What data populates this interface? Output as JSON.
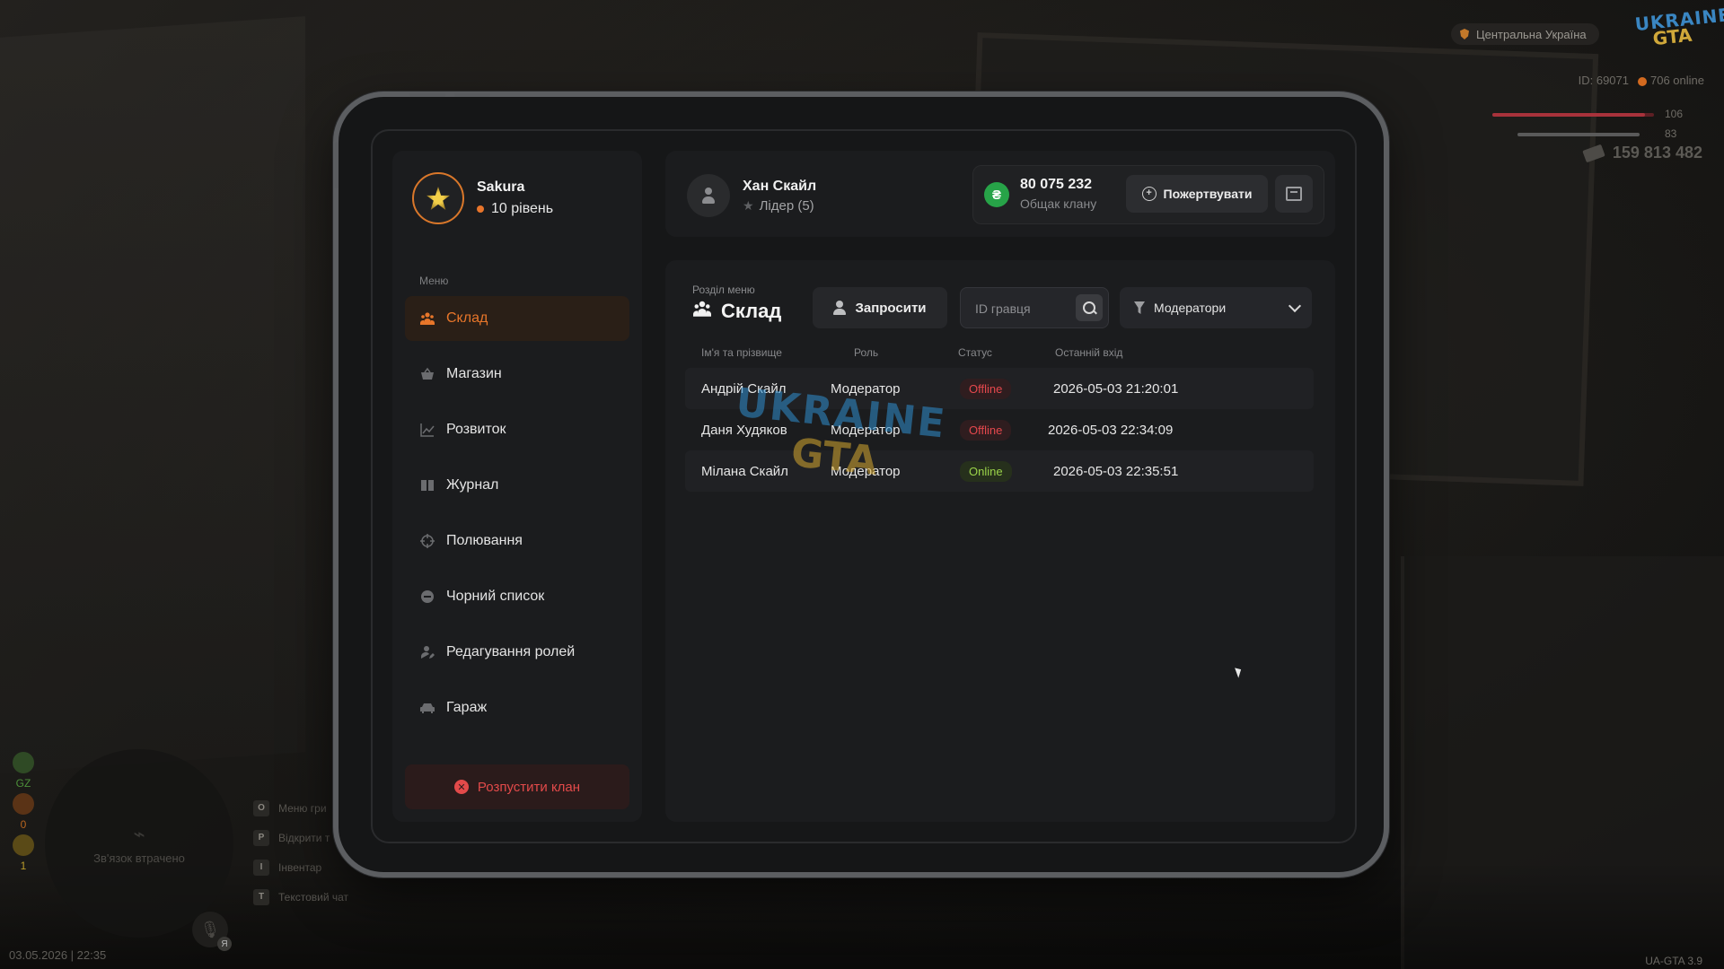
{
  "hud": {
    "region": "Центральна Україна",
    "logo_line1": "UKRAINE",
    "logo_line2": "GTA",
    "id_text": "ID: 69071",
    "online_text": "706 online",
    "health_value": "106",
    "armor_value": "83",
    "money": "159 813 482",
    "connection_text": "Зв'язок втрачено",
    "left_icons": [
      {
        "text": "GZ",
        "color": "#4c8f3a"
      },
      {
        "text": "0",
        "color": "#b8651f"
      },
      {
        "text": "1",
        "color": "#b89a2a"
      }
    ],
    "hints": [
      {
        "key": "O",
        "label": "Меню гри"
      },
      {
        "key": "P",
        "label": "Відкрити т"
      },
      {
        "key": "I",
        "label": "Інвентар"
      },
      {
        "key": "T",
        "label": "Текстовий чат"
      }
    ],
    "mic_badge": "Я",
    "datetime": "03.05.2026 | 22:35",
    "version": "UA-GTA 3.9"
  },
  "profile": {
    "name": "Sakura",
    "level": "10 рівень"
  },
  "menu": {
    "caption": "Меню",
    "items": [
      {
        "label": "Склад",
        "icon": "group-icon",
        "active": true
      },
      {
        "label": "Магазин",
        "icon": "basket-icon",
        "active": false
      },
      {
        "label": "Розвиток",
        "icon": "chart-icon",
        "active": false
      },
      {
        "label": "Журнал",
        "icon": "book-icon",
        "active": false
      },
      {
        "label": "Полювання",
        "icon": "crosshair-icon",
        "active": false
      },
      {
        "label": "Чорний список",
        "icon": "block-icon",
        "active": false
      },
      {
        "label": "Редагування ролей",
        "icon": "user-edit-icon",
        "active": false
      },
      {
        "label": "Гараж",
        "icon": "car-icon",
        "active": false
      }
    ],
    "disband_label": "Розпустити клан"
  },
  "leader": {
    "name": "Хан Скайл",
    "role": "Лідер (5)"
  },
  "treasury": {
    "currency_symbol": "₴",
    "amount": "80 075 232",
    "label": "Общак клану",
    "donate_label": "Пожертвувати"
  },
  "section": {
    "caption": "Розділ меню",
    "title": "Склад",
    "invite_label": "Запросити",
    "search_placeholder": "ID гравця",
    "filter_value": "Модератори"
  },
  "table": {
    "headers": [
      "Ім'я та прізвище",
      "Роль",
      "Статус",
      "Останній вхід"
    ],
    "rows": [
      {
        "name": "Андрій Скайл",
        "role": "Модератор",
        "status": "Offline",
        "last_login": "2026-05-03 21:20:01"
      },
      {
        "name": "Даня Худяков",
        "role": "Модератор",
        "status": "Offline",
        "last_login": "2026-05-03 22:34:09"
      },
      {
        "name": "Мілана Скайл",
        "role": "Модератор",
        "status": "Online",
        "last_login": "2026-05-03 22:35:51"
      }
    ]
  },
  "watermark": {
    "line1": "UKRAINE",
    "line2": "GTA"
  },
  "colors": {
    "accent": "#e8762a",
    "offline": "#e5484d",
    "online": "#9bd34a",
    "treasury_green": "#27a348",
    "danger": "#e24a4a"
  }
}
